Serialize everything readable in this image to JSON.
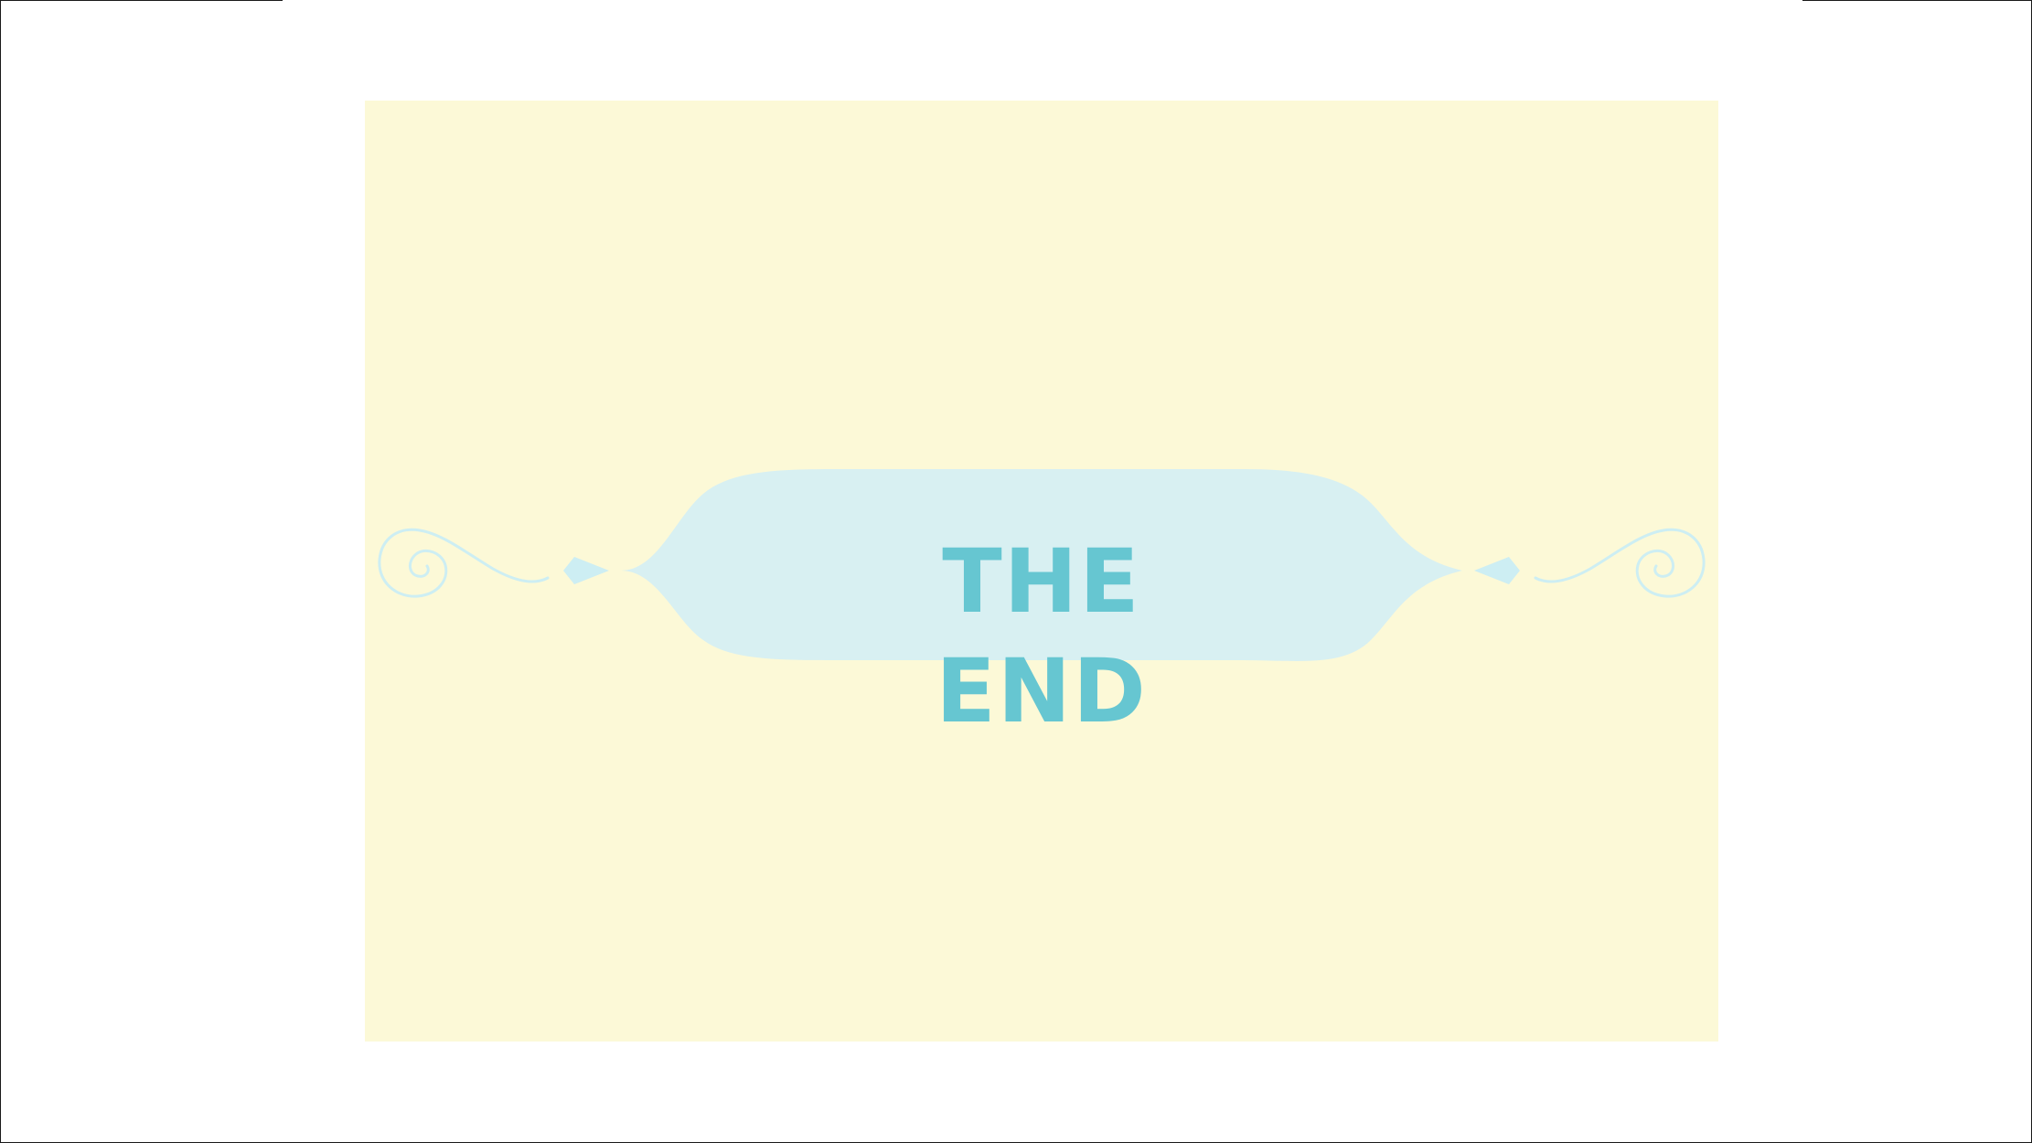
{
  "slide": {
    "title": "THE END"
  },
  "colors": {
    "page_background": "#ffffff",
    "slide_background": "#fcf9d7",
    "banner_fill": "#d8f0f2",
    "title_color": "#66c6d1",
    "flourish_color": "#cdeef3"
  },
  "icons": {
    "left_flourish": "swirl-flourish-icon",
    "right_flourish": "swirl-flourish-icon",
    "left_diamond": "diamond-icon",
    "right_diamond": "diamond-icon"
  }
}
